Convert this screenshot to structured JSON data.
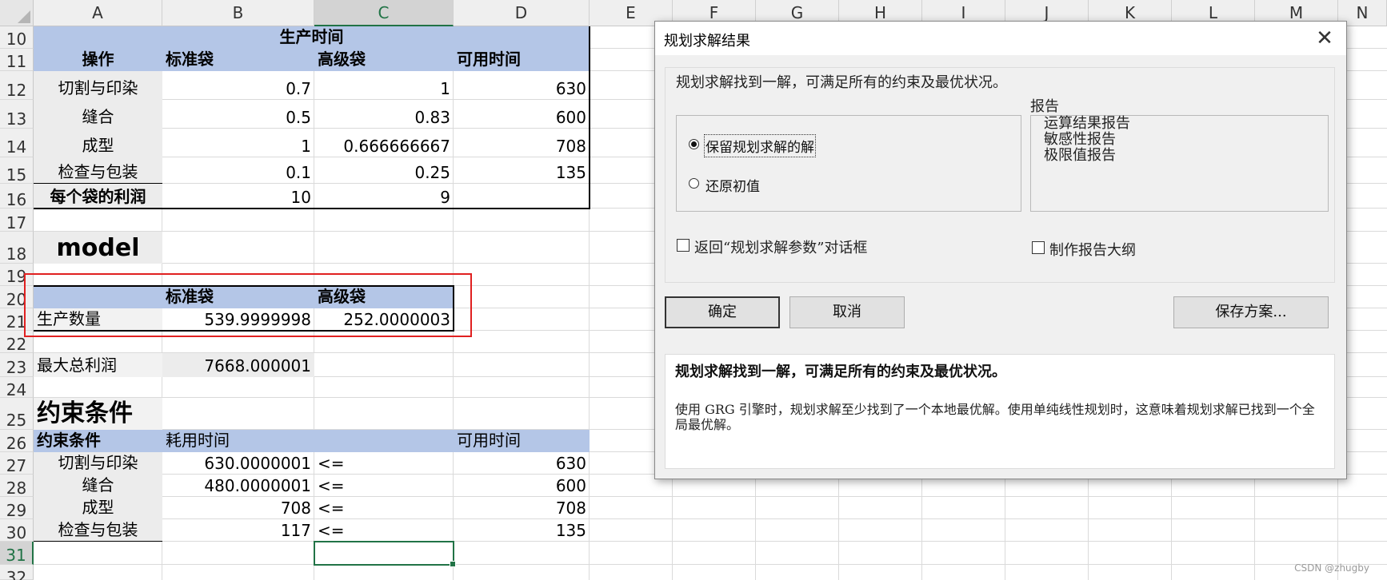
{
  "columns": [
    "A",
    "B",
    "C",
    "D",
    "E",
    "F",
    "G",
    "H",
    "I",
    "J",
    "K",
    "L",
    "M",
    "N"
  ],
  "selected_column": "C",
  "rows": [
    "10",
    "11",
    "12",
    "13",
    "14",
    "15",
    "16",
    "17",
    "18",
    "19",
    "20",
    "21",
    "22",
    "23",
    "24",
    "25",
    "26",
    "27",
    "28",
    "29",
    "30",
    "31",
    "32"
  ],
  "selected_row": "31",
  "sheet": {
    "production_time_header": "生产时间",
    "col_operation": "操作",
    "col_standard_bag": "标准袋",
    "col_deluxe_bag": "高级袋",
    "col_available_time": "可用时间",
    "operations": [
      {
        "name": "切割与印染",
        "standard": "0.7",
        "deluxe": "1",
        "available": "630"
      },
      {
        "name": "缝合",
        "standard": "0.5",
        "deluxe": "0.83",
        "available": "600"
      },
      {
        "name": "成型",
        "standard": "1",
        "deluxe": "0.666666667",
        "available": "708"
      },
      {
        "name": "检查与包装",
        "standard": "0.1",
        "deluxe": "0.25",
        "available": "135"
      }
    ],
    "profit_label": "每个袋的利润",
    "profit_standard": "10",
    "profit_deluxe": "9",
    "model_label": "model",
    "decision_header_standard": "标准袋",
    "decision_header_deluxe": "高级袋",
    "quantity_label": "生产数量",
    "quantity_standard": "539.9999998",
    "quantity_deluxe": "252.0000003",
    "max_profit_label": "最大总利润",
    "max_profit_value": "7668.000001",
    "constraints_title": "约束条件",
    "constraints_header": "约束条件",
    "time_used_header": "耗用时间",
    "available_header": "可用时间",
    "constraints": [
      {
        "name": "切割与印染",
        "used": "630.0000001",
        "op": "<=",
        "available": "630"
      },
      {
        "name": "缝合",
        "used": "480.0000001",
        "op": "<=",
        "available": "600"
      },
      {
        "name": "成型",
        "used": "708",
        "op": "<=",
        "available": "708"
      },
      {
        "name": "检查与包装",
        "used": "117",
        "op": "<=",
        "available": "135"
      }
    ]
  },
  "dialog": {
    "title": "规划求解结果",
    "close_symbol": "✕",
    "found_message": "规划求解找到一解，可满足所有的约束及最优状况。",
    "keep_solution": "保留规划求解的解",
    "restore_values": "还原初值",
    "reports_label": "报告",
    "reports": [
      "运算结果报告",
      "敏感性报告",
      "极限值报告"
    ],
    "return_dialog": "返回“规划求解参数”对话框",
    "outline_reports": "制作报告大纲",
    "ok": "确定",
    "cancel": "取消",
    "save_scenario": "保存方案...",
    "detail_title": "规划求解找到一解，可满足所有的约束及最优状况。",
    "detail_text": "使用 GRG 引擎时，规划求解至少找到了一个本地最优解。使用单纯线性规划时，这意味着规划求解已找到一个全局最优解。"
  },
  "watermark": "CSDN @zhugby"
}
